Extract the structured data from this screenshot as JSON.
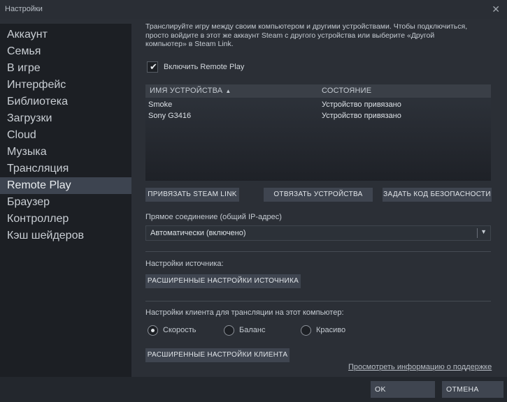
{
  "window": {
    "title": "Настройки",
    "close_icon": "close-icon"
  },
  "sidebar": {
    "items": [
      {
        "label": "Аккаунт"
      },
      {
        "label": "Семья"
      },
      {
        "label": "В игре"
      },
      {
        "label": "Интерфейс"
      },
      {
        "label": "Библиотека"
      },
      {
        "label": "Загрузки"
      },
      {
        "label": "Cloud"
      },
      {
        "label": "Музыка"
      },
      {
        "label": "Трансляция"
      },
      {
        "label": "Remote Play",
        "active": true
      },
      {
        "label": "Браузер"
      },
      {
        "label": "Контроллер"
      },
      {
        "label": "Кэш шейдеров"
      }
    ]
  },
  "main": {
    "intro_line1": "Транслируйте игру между своим компьютером и другими устройствами. Чтобы подключиться,",
    "intro_line2": "просто войдите в этот же аккаунт Steam с другого устройства или выберите «Другой",
    "intro_line3": "компьютер» в Steam Link.",
    "enable_checkbox": {
      "label": "Включить Remote Play",
      "checked": true
    },
    "devices": {
      "col_name": "ИМЯ УСТРОЙСТВА",
      "col_status": "СОСТОЯНИЕ",
      "sort_icon": "sort-up-icon",
      "rows": [
        {
          "name": "Smoke",
          "status": "Устройство привязано"
        },
        {
          "name": "Sony G3416",
          "status": "Устройство привязано"
        }
      ]
    },
    "buttons": {
      "pair_steam_link": "ПРИВЯЗАТЬ STEAM LINK",
      "unpair_devices": "ОТВЯЗАТЬ УСТРОЙСТВА",
      "set_security_code": "ЗАДАТЬ КОД БЕЗОПАСНОСТИ"
    },
    "direct_connection": {
      "label": "Прямое соединение (общий IP-адрес)",
      "value": "Автоматически (включено)"
    },
    "host_settings": {
      "label": "Настройки источника:",
      "advanced_button": "РАСШИРЕННЫЕ НАСТРОЙКИ ИСТОЧНИКА"
    },
    "client_settings": {
      "label": "Настройки клиента для трансляции на этот компьютер:",
      "options": [
        {
          "label": "Скорость",
          "selected": true
        },
        {
          "label": "Баланс",
          "selected": false
        },
        {
          "label": "Красиво",
          "selected": false
        }
      ],
      "advanced_button": "РАСШИРЕННЫЕ НАСТРОЙКИ КЛИЕНТА"
    },
    "support_link": "Просмотреть информацию о поддержке"
  },
  "footer": {
    "ok": "OK",
    "cancel": "ОТМЕНА"
  }
}
